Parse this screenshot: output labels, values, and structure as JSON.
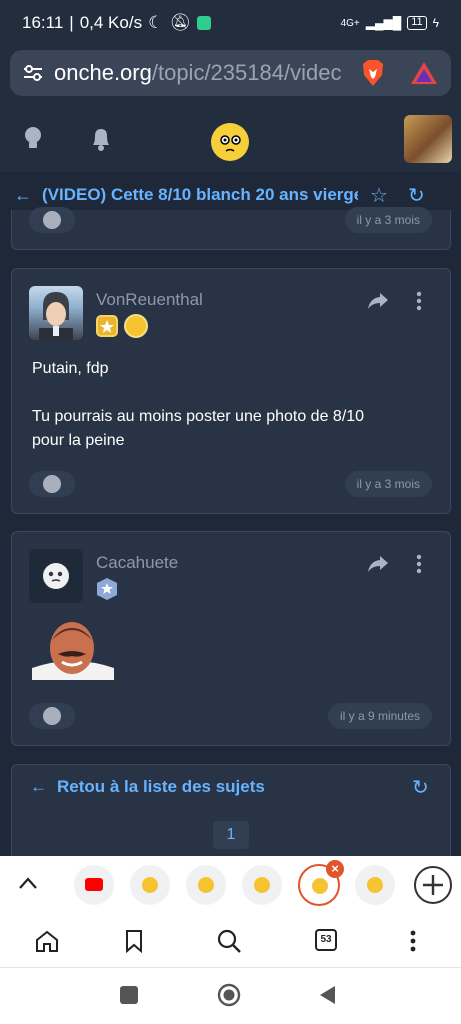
{
  "status": {
    "time": "16:11",
    "net": "0,4 Ko/s",
    "signal": "4G+",
    "battery": "11"
  },
  "browser": {
    "url_host": "onche.org",
    "url_path": "/topic/235184/videc",
    "tabs_count": "53"
  },
  "topic": {
    "title": "(VIDEO) Cette 8/10 blanch 20 ans vierge"
  },
  "prev_post": {
    "time": "il y a 3 mois"
  },
  "posts": [
    {
      "username": "VonReuenthal",
      "lines": [
        "Putain, fdp",
        "",
        "Tu pourrais au moins poster une photo de 8/10",
        "pour la peine"
      ],
      "time": "il y a 3 mois"
    },
    {
      "username": "Cacahuete",
      "time": "il y a 9 minutes"
    }
  ],
  "footer": {
    "back_label": "Retou à la liste des sujets",
    "page": "1"
  },
  "colors": {
    "accent": "#67b3ff",
    "background": "#1e2838",
    "card": "#283446"
  }
}
